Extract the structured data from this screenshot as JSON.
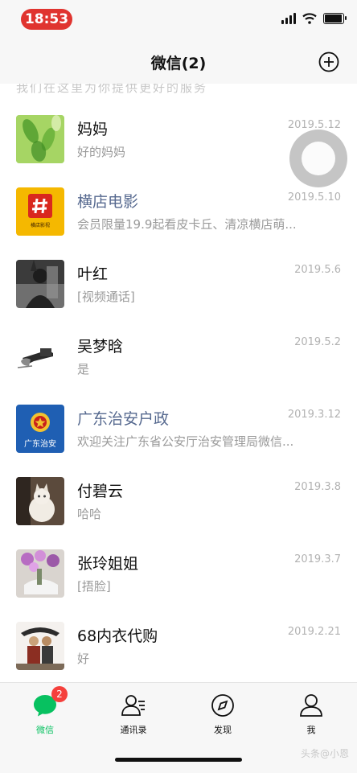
{
  "status_bar": {
    "time": "18:53"
  },
  "nav": {
    "title": "微信(2)"
  },
  "partial_row_text": "我们在这里为你提供更好的服务",
  "chats": [
    {
      "name": "妈妈",
      "time": "2019.5.12",
      "preview": "好的妈妈",
      "official": false
    },
    {
      "name": "横店电影",
      "time": "2019.5.10",
      "preview": "会员限量19.9起看皮卡丘、清凉横店萌...",
      "official": true,
      "avatar_text": "横店影视"
    },
    {
      "name": "叶红",
      "time": "2019.5.6",
      "preview": "[视频通话]",
      "official": false
    },
    {
      "name": "吴梦晗",
      "time": "2019.5.2",
      "preview": "是",
      "official": false
    },
    {
      "name": "广东治安户政",
      "time": "2019.3.12",
      "preview": "欢迎关注广东省公安厅治安管理局微信...",
      "official": true,
      "avatar_text": "广东治安"
    },
    {
      "name": "付碧云",
      "time": "2019.3.8",
      "preview": "哈哈",
      "official": false
    },
    {
      "name": "张玲姐姐",
      "time": "2019.3.7",
      "preview": "[捂脸]",
      "official": false
    },
    {
      "name": "68内衣代购",
      "time": "2019.2.21",
      "preview": "好",
      "official": false
    }
  ],
  "tabbar": {
    "tabs": [
      {
        "label": "微信",
        "icon": "chat-bubble-icon",
        "active": true,
        "badge": "2"
      },
      {
        "label": "通讯录",
        "icon": "contacts-icon",
        "active": false
      },
      {
        "label": "发现",
        "icon": "compass-icon",
        "active": false
      },
      {
        "label": "我",
        "icon": "person-icon",
        "active": false
      }
    ]
  },
  "watermark": "头条@小恩",
  "colors": {
    "accent": "#07c160",
    "badge": "#f5403c",
    "time_pill": "#e0342f",
    "official_name": "#56698f"
  }
}
